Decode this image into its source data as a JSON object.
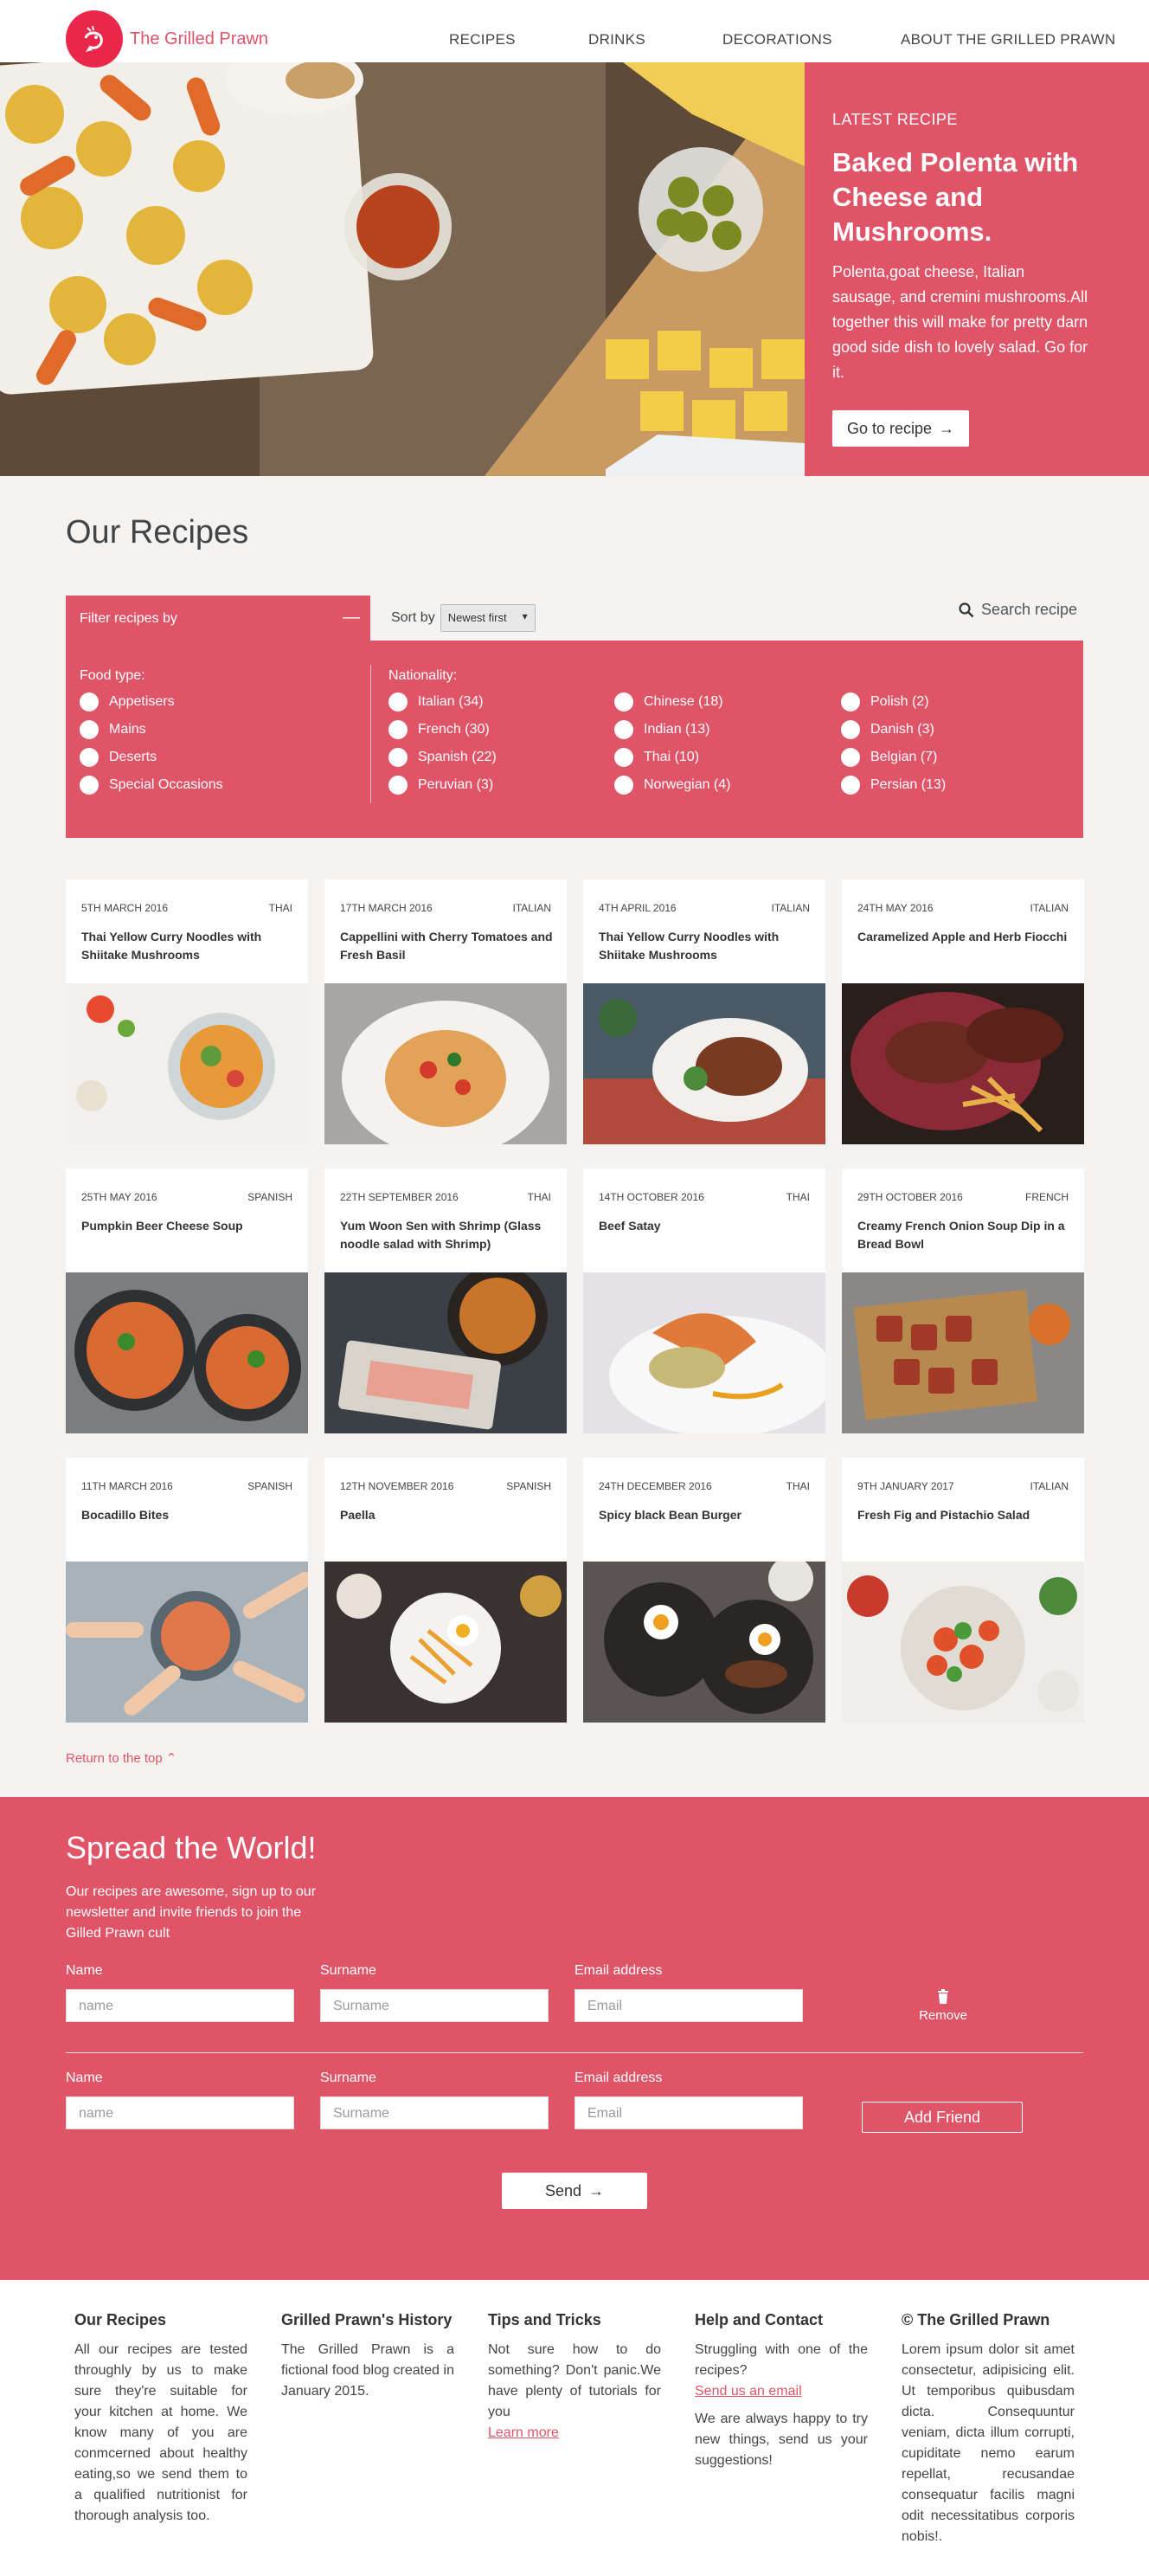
{
  "header": {
    "brand": "The Grilled Prawn",
    "nav": [
      "RECIPES",
      "DRINKS",
      "DECORATIONS",
      "ABOUT THE GRILLED PRAWN"
    ]
  },
  "hero": {
    "kicker": "LATEST RECIPE",
    "title": "Baked Polenta with Cheese and Mushrooms.",
    "description": "Polenta,goat cheese, Italian sausage, and cremini mushrooms.All together this will make for pretty darn good side dish to lovely salad. Go for it.",
    "button": "Go to recipe"
  },
  "recipes": {
    "title": "Our Recipes",
    "filter_label": "Filter recipes by",
    "sort_label": "Sort by",
    "sort_value": "Newest first",
    "search_placeholder": "Search recipe",
    "food_type_heading": "Food type:",
    "food_types": [
      "Appetisers",
      "Mains",
      "Deserts",
      "Special Occasions"
    ],
    "nationality_heading": "Nationality:",
    "nationalities": [
      "Italian (34)",
      "French (30)",
      "Spanish (22)",
      "Peruvian (3)",
      "Chinese (18)",
      "Indian (13)",
      "Thai (10)",
      "Norwegian (4)",
      "Polish (2)",
      "Danish (3)",
      "Belgian (7)",
      "Persian (13)"
    ],
    "cards": [
      {
        "date": "5TH MARCH 2016",
        "category": "THAI",
        "title": "Thai Yellow Curry Noodles with Shiitake Mushrooms"
      },
      {
        "date": "17TH MARCH 2016",
        "category": "ITALIAN",
        "title": "Cappellini with Cherry Tomatoes and Fresh Basil"
      },
      {
        "date": "4TH APRIL 2016",
        "category": "ITALIAN",
        "title": "Thai Yellow Curry Noodles with Shiitake Mushrooms"
      },
      {
        "date": "24TH MAY 2016",
        "category": "ITALIAN",
        "title": "Caramelized Apple and Herb Fiocchi"
      },
      {
        "date": "25TH MAY 2016",
        "category": "SPANISH",
        "title": "Pumpkin Beer Cheese Soup"
      },
      {
        "date": "22TH SEPTEMBER 2016",
        "category": "THAI",
        "title": "Yum Woon Sen with Shrimp (Glass noodle salad with Shrimp)"
      },
      {
        "date": "14TH OCTOBER 2016",
        "category": "THAI",
        "title": "Beef Satay"
      },
      {
        "date": "29TH OCTOBER 2016",
        "category": "FRENCH",
        "title": "Creamy French Onion Soup Dip in a Bread Bowl"
      },
      {
        "date": "11TH MARCH 2016",
        "category": "SPANISH",
        "title": "Bocadillo Bites"
      },
      {
        "date": "12TH NOVEMBER 2016",
        "category": "SPANISH",
        "title": "Paella"
      },
      {
        "date": "24TH DECEMBER 2016",
        "category": "THAI",
        "title": "Spicy black Bean Burger"
      },
      {
        "date": "9TH JANUARY 2017",
        "category": "ITALIAN",
        "title": "Fresh Fig and Pistachio Salad"
      }
    ],
    "return_top": "Return to the top"
  },
  "newsletter": {
    "title": "Spread the World!",
    "description": "Our recipes are awesome, sign up to our newsletter and invite friends to join the Gilled Prawn cult",
    "name_label": "Name",
    "surname_label": "Surname",
    "email_label": "Email address",
    "name_placeholder": "name",
    "surname_placeholder": "Surname",
    "email_placeholder": "Email",
    "remove": "Remove",
    "add_friend": "Add Friend",
    "send": "Send"
  },
  "footer": {
    "col1_title": "Our Recipes",
    "col1_text": "All our recipes are tested throughly by us to make sure they're suitable for your kitchen at home. We know many of you are conmcerned about healthy eating,so we send them to a qualified nutritionist for thorough analysis too.",
    "col2_title": "Grilled Prawn's History",
    "col2_text": "The Grilled Prawn is a fictional food blog created in January 2015.",
    "col3_title": "Tips and Tricks",
    "col3_text": "Not sure how to do something? Don't panic.We have plenty of tutorials for you",
    "col3_link": "Learn more",
    "col4_title": "Help and Contact",
    "col4_text": "Struggling with one of the recipes?",
    "col4_link": "Send us an email",
    "col4_text2": "We are always happy to try new things, send us your suggestions!",
    "col5_title": "© The Grilled Prawn",
    "col5_text": "Lorem ipsum dolor sit amet consectetur, adipisicing elit. Ut temporibus quibusdam dicta. Consequuntur veniam, dicta illum corrupti, cupiditate nemo earum repellat, recusandae consequatur facilis magni odit necessitatibus corporis nobis!."
  }
}
